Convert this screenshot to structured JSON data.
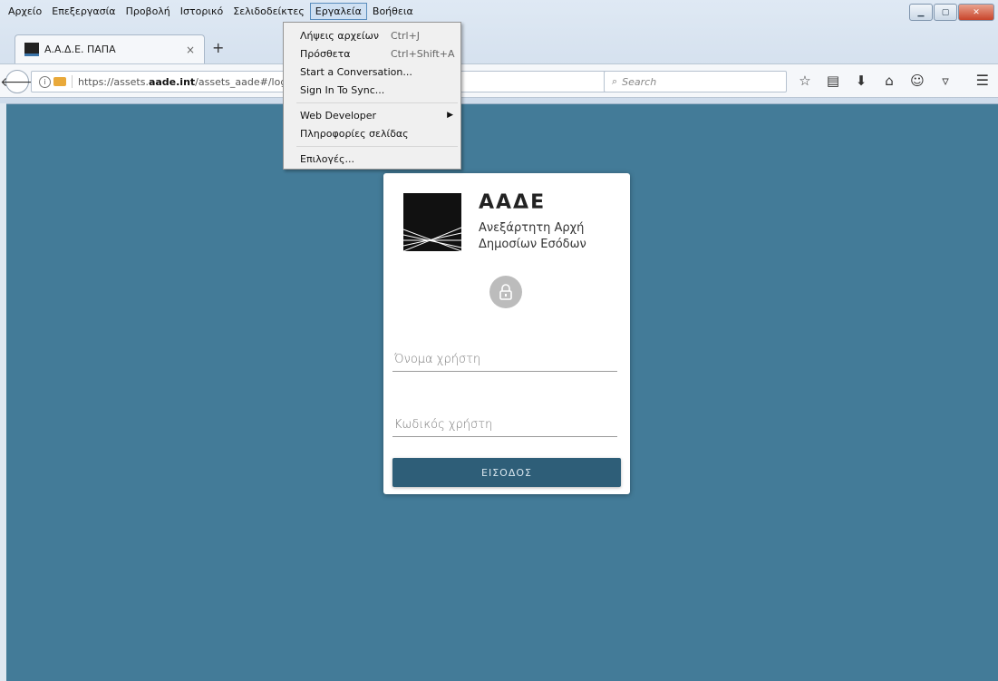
{
  "menubar": {
    "items": [
      "Αρχείο",
      "Επεξεργασία",
      "Προβολή",
      "Ιστορικό",
      "Σελιδοδείκτες",
      "Εργαλεία",
      "Βοήθεια"
    ],
    "active_index": 5
  },
  "tab": {
    "title": "Α.Α.Δ.Ε. ΠΑΠΑ",
    "close": "×",
    "new_tab": "+"
  },
  "urlbar": {
    "prefix": "https://assets.",
    "domain": "aade.int",
    "path": "/assets_aade#/login"
  },
  "searchbar": {
    "placeholder": "Search"
  },
  "tools_menu": {
    "items": [
      {
        "label": "Λήψεις αρχείων",
        "shortcut": "Ctrl+J"
      },
      {
        "label": "Πρόσθετα",
        "shortcut": "Ctrl+Shift+A"
      },
      {
        "label": "Start a Conversation...",
        "shortcut": ""
      },
      {
        "label": "Sign In To Sync...",
        "shortcut": ""
      },
      {
        "label": "Web Developer",
        "shortcut": "",
        "submenu": true
      },
      {
        "label": "Πληροφορίες σελίδας",
        "shortcut": ""
      },
      {
        "label": "Επιλογές...",
        "shortcut": ""
      }
    ]
  },
  "login": {
    "brand_title": "ΑΑΔΕ",
    "brand_subtitle_1": "Ανεξάρτητη Αρχή",
    "brand_subtitle_2": "Δημοσίων Εσόδων",
    "username_placeholder": "Όνομα χρήστη",
    "password_placeholder": "Κωδικός χρήστη",
    "submit_label": "ΕΙΣΟΔΟΣ"
  },
  "colors": {
    "page_background": "#437b98",
    "button": "#2e5e78"
  }
}
